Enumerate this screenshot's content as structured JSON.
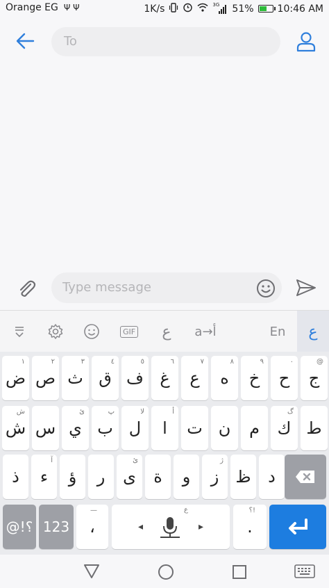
{
  "status_bar": {
    "carrier": "Orange EG",
    "usb_icons": "Ψ Ψ",
    "speed": "1K/s",
    "signal_badge": "3G",
    "battery": "51%",
    "time": "10:46 AM"
  },
  "header": {
    "to_placeholder": "To"
  },
  "compose": {
    "message_placeholder": "Type message"
  },
  "toolbar": {
    "gif_label": "GIF",
    "translit_label": "a→أ",
    "arabic_script_glyph": "ع",
    "en_label": "En",
    "active_lang": "ع"
  },
  "keyboard": {
    "row1": [
      {
        "ch": "ض",
        "hint": "١"
      },
      {
        "ch": "ص",
        "hint": "٢"
      },
      {
        "ch": "ث",
        "hint": "٣"
      },
      {
        "ch": "ق",
        "hint": "٤"
      },
      {
        "ch": "ف",
        "hint": "٥"
      },
      {
        "ch": "غ",
        "hint": "٦"
      },
      {
        "ch": "ع",
        "hint": "٧"
      },
      {
        "ch": "ه",
        "hint": "٨"
      },
      {
        "ch": "خ",
        "hint": "٩"
      },
      {
        "ch": "ح",
        "hint": "٠"
      },
      {
        "ch": "ج",
        "hint": "@"
      }
    ],
    "row2": [
      {
        "ch": "ش",
        "hint": "ش"
      },
      {
        "ch": "س",
        "hint": ""
      },
      {
        "ch": "ي",
        "hint": "ئ"
      },
      {
        "ch": "ب",
        "hint": "پ"
      },
      {
        "ch": "ل",
        "hint": "لا"
      },
      {
        "ch": "ا",
        "hint": "أ"
      },
      {
        "ch": "ت",
        "hint": ""
      },
      {
        "ch": "ن",
        "hint": ""
      },
      {
        "ch": "م",
        "hint": ""
      },
      {
        "ch": "ك",
        "hint": "گ"
      },
      {
        "ch": "ط",
        "hint": ""
      }
    ],
    "row3": [
      {
        "ch": "ذ",
        "hint": ""
      },
      {
        "ch": "ء",
        "hint": "آ"
      },
      {
        "ch": "ؤ",
        "hint": ""
      },
      {
        "ch": "ر",
        "hint": ""
      },
      {
        "ch": "ى",
        "hint": "ئ"
      },
      {
        "ch": "ة",
        "hint": ""
      },
      {
        "ch": "و",
        "hint": ""
      },
      {
        "ch": "ز",
        "hint": "ژ"
      },
      {
        "ch": "ظ",
        "hint": ""
      },
      {
        "ch": "د",
        "hint": ""
      }
    ],
    "row4": {
      "symbols": "@!؟",
      "numbers": "123",
      "comma": "،",
      "comma_hint": "—",
      "space_left": "◂",
      "space_right": "▸",
      "space_hint": "ع",
      "period": ".",
      "period_hint": "؟!"
    }
  },
  "colors": {
    "accent": "#1d7de0",
    "battery_green": "#2dbb3a"
  }
}
